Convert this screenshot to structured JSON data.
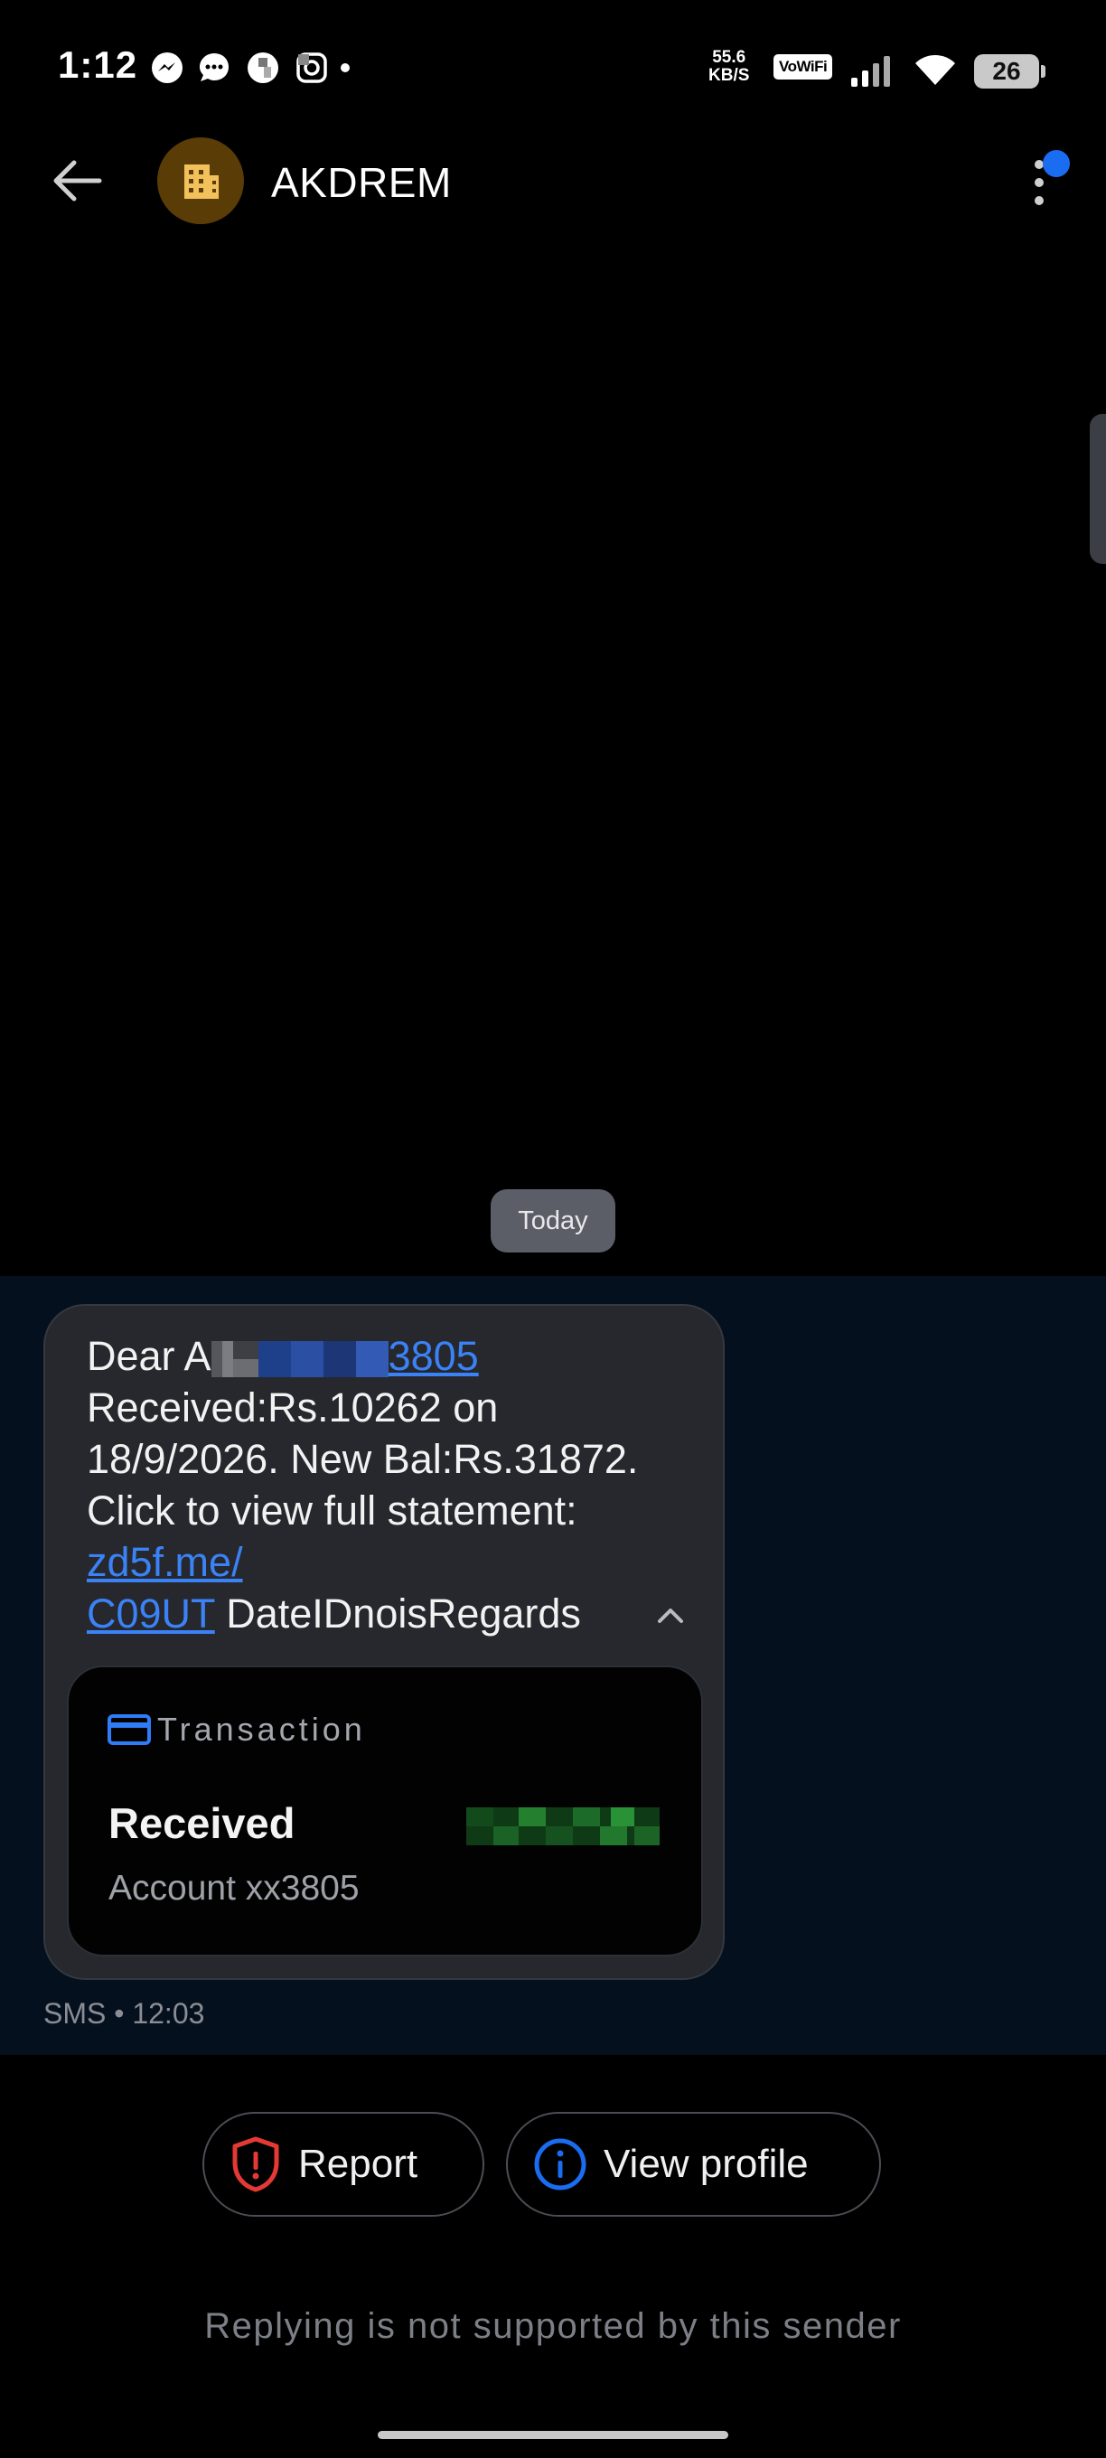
{
  "status_bar": {
    "time": "1:12",
    "network_speed_value": "55.6",
    "network_speed_unit": "KB/S",
    "vowifi": "VoWiFi",
    "battery": "26",
    "icons": [
      "messenger-icon",
      "chat-bubble-icon",
      "facebook-icon",
      "instagram-icon",
      "dot-icon",
      "signal-icon",
      "wifi-icon",
      "battery-icon"
    ]
  },
  "header": {
    "title": "AKDREM",
    "avatar_icon": "building-icon",
    "accent": "#1a6cf0"
  },
  "thread": {
    "date_chip": "Today",
    "message": {
      "line1_prefix": "Dear A",
      "line1_link_suffix": "3805",
      "body_text": "Received:Rs.10262 on 18/9/2026. New Bal:Rs.31872. Click to view full statement: ",
      "link_text": "zd5f.me/\nC09UT",
      "tail_text": " DateIDnoisRegards"
    },
    "transaction_card": {
      "label": "Transaction",
      "status": "Received",
      "account": "Account xx3805"
    },
    "meta": "SMS • 12:03"
  },
  "actions": {
    "report_label": "Report",
    "view_profile_label": "View profile"
  },
  "footer": {
    "reply_note": "Replying is not supported by this sender"
  },
  "colors": {
    "link": "#3b82f6",
    "report_icon": "#e53935",
    "profile_icon": "#1a6cf0",
    "bubble_bg": "#26282d",
    "thread_bg": "#05101f"
  }
}
